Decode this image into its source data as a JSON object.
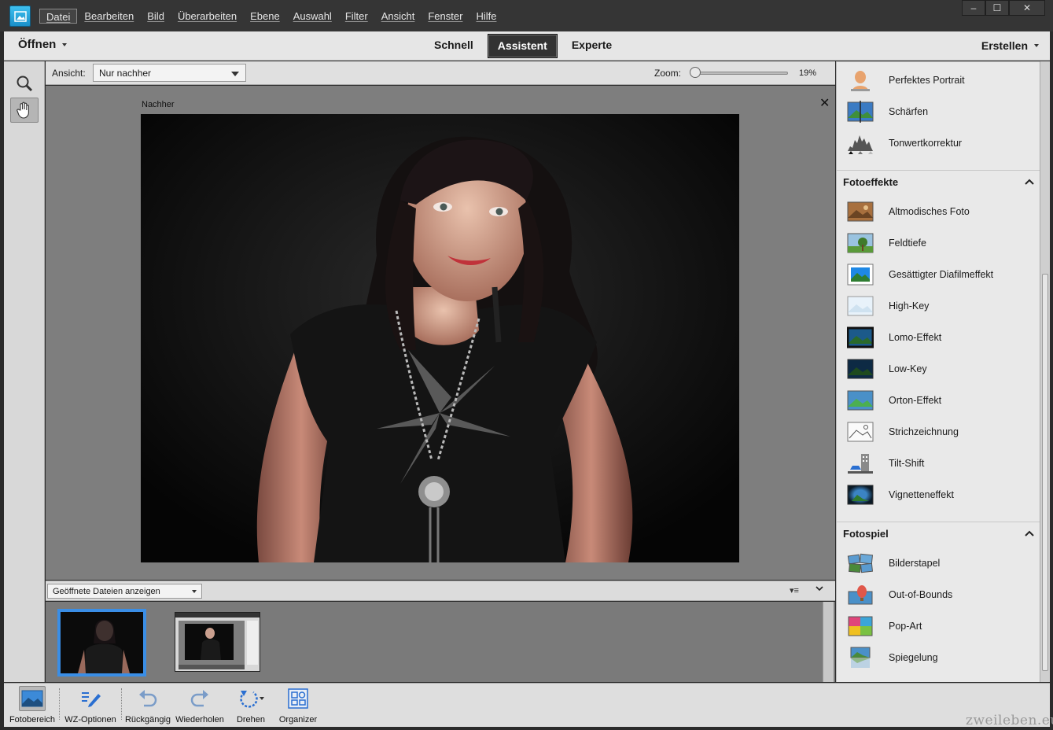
{
  "menu": {
    "items": [
      "Datei",
      "Bearbeiten",
      "Bild",
      "Überarbeiten",
      "Ebene",
      "Auswahl",
      "Filter",
      "Ansicht",
      "Fenster",
      "Hilfe"
    ],
    "active_index": 0
  },
  "window": {
    "minimize": "‒",
    "maximize": "☐",
    "close": "✕"
  },
  "modebar": {
    "open_label": "Öffnen",
    "tabs": [
      {
        "label": "Schnell"
      },
      {
        "label": "Assistent"
      },
      {
        "label": "Experte"
      }
    ],
    "active_tab": 1,
    "create_label": "Erstellen"
  },
  "tools": [
    {
      "icon": "zoom-icon"
    },
    {
      "icon": "hand-icon",
      "selected": true
    }
  ],
  "options": {
    "view_label": "Ansicht:",
    "view_value": "Nur nachher",
    "zoom_label": "Zoom:",
    "zoom_value": "19%",
    "zoom_fraction": 0.03
  },
  "canvas": {
    "view_title": "Nachher",
    "close_glyph": "✕"
  },
  "bin": {
    "select_value": "Geöffnete Dateien anzeigen",
    "thumbnails": [
      {
        "selected": true
      },
      {
        "selected": false
      }
    ]
  },
  "panel": {
    "top_items": [
      {
        "label": "Perfektes Portrait",
        "icon": "portrait-icon"
      },
      {
        "label": "Schärfen",
        "icon": "sharpen-icon"
      },
      {
        "label": "Tonwertkorrektur",
        "icon": "levels-icon"
      }
    ],
    "sections": [
      {
        "title": "Fotoeffekte",
        "items": [
          {
            "label": "Altmodisches Foto",
            "icon": "old-photo-icon"
          },
          {
            "label": "Feldtiefe",
            "icon": "depth-of-field-icon"
          },
          {
            "label": "Gesättigter Diafilmeffekt",
            "icon": "saturated-slide-icon"
          },
          {
            "label": "High-Key",
            "icon": "high-key-icon"
          },
          {
            "label": "Lomo-Effekt",
            "icon": "lomo-icon"
          },
          {
            "label": "Low-Key",
            "icon": "low-key-icon"
          },
          {
            "label": "Orton-Effekt",
            "icon": "orton-icon"
          },
          {
            "label": "Strichzeichnung",
            "icon": "line-drawing-icon"
          },
          {
            "label": "Tilt-Shift",
            "icon": "tilt-shift-icon"
          },
          {
            "label": "Vignetteneffekt",
            "icon": "vignette-icon"
          }
        ]
      },
      {
        "title": "Fotospiel",
        "items": [
          {
            "label": "Bilderstapel",
            "icon": "picture-stack-icon"
          },
          {
            "label": "Out-of-Bounds",
            "icon": "out-of-bounds-icon"
          },
          {
            "label": "Pop-Art",
            "icon": "pop-art-icon"
          },
          {
            "label": "Spiegelung",
            "icon": "reflection-icon"
          }
        ]
      }
    ]
  },
  "bottombar": {
    "buttons": [
      {
        "label": "Fotobereich",
        "icon": "photo-bin-icon",
        "active": true
      },
      {
        "label": "WZ-Optionen",
        "icon": "tool-options-icon"
      },
      {
        "label": "Rückgängig",
        "icon": "undo-icon"
      },
      {
        "label": "Wiederholen",
        "icon": "redo-icon"
      },
      {
        "label": "Drehen",
        "icon": "rotate-icon"
      },
      {
        "label": "Organizer",
        "icon": "organizer-icon"
      }
    ]
  },
  "watermark": "zweileben.eu"
}
